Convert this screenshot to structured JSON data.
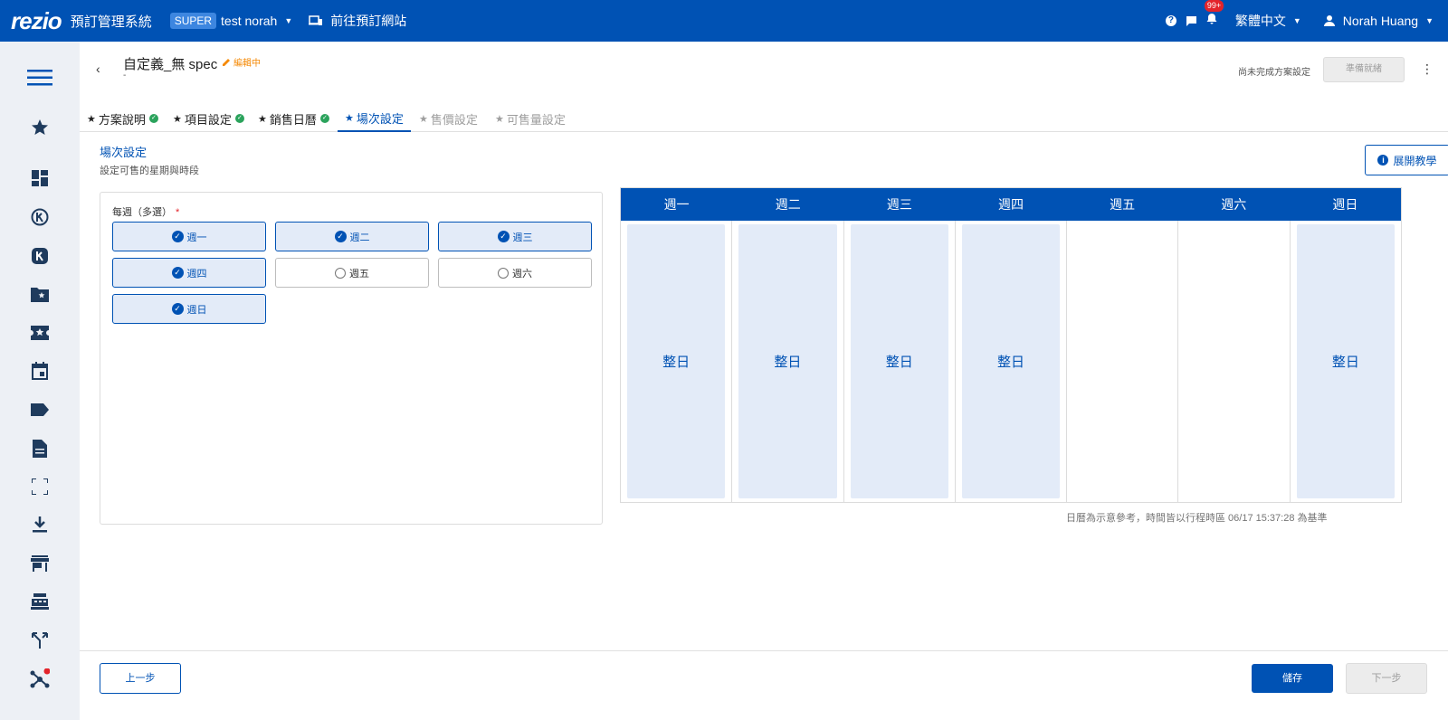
{
  "topbar": {
    "logo": "rezio",
    "system_title": "預訂管理系統",
    "super_badge": "SUPER",
    "org_name": "test norah",
    "site_link": "前往預訂網站",
    "notification_count": "99+",
    "language": "繁體中文",
    "user_name": "Norah Huang"
  },
  "sidebar": {
    "icons": [
      "menu-icon",
      "star-icon",
      "dashboard-icon",
      "k-circle-icon",
      "k-square-icon",
      "folder-star-icon",
      "ticket-star-icon",
      "calendar-icon",
      "tag-icon",
      "document-icon",
      "fullscreen-icon",
      "download-icon",
      "store-icon",
      "cashier-icon",
      "split-icon",
      "network-icon"
    ]
  },
  "header": {
    "back": "‹",
    "title": "自定義_無 spec",
    "edit_status": "編輯中",
    "subtitle": "-",
    "incomplete_text": "尚未完成方案設定",
    "ready_button": "準備就緒",
    "more": "⋮"
  },
  "tabs": [
    {
      "label": "方案說明",
      "state": "done"
    },
    {
      "label": "項目設定",
      "state": "done"
    },
    {
      "label": "銷售日曆",
      "state": "done"
    },
    {
      "label": "場次設定",
      "state": "active"
    },
    {
      "label": "售價設定",
      "state": "disabled"
    },
    {
      "label": "可售量設定",
      "state": "disabled"
    }
  ],
  "section": {
    "title": "場次設定",
    "description": "設定可售的星期與時段",
    "tutorial_button": "展開教學"
  },
  "week_selector": {
    "label": "每週（多選）",
    "required_mark": "*",
    "days": [
      {
        "label": "週一",
        "selected": true
      },
      {
        "label": "週二",
        "selected": true
      },
      {
        "label": "週三",
        "selected": true
      },
      {
        "label": "週四",
        "selected": true
      },
      {
        "label": "週五",
        "selected": false
      },
      {
        "label": "週六",
        "selected": false
      },
      {
        "label": "週日",
        "selected": true
      }
    ]
  },
  "calendar": {
    "headers": [
      "週一",
      "週二",
      "週三",
      "週四",
      "週五",
      "週六",
      "週日"
    ],
    "slots": [
      "整日",
      "整日",
      "整日",
      "整日",
      "",
      "",
      "整日"
    ],
    "note": "日曆為示意參考，時間皆以行程時區  06/17 15:37:28 為基準"
  },
  "footer": {
    "prev_button": "上一步",
    "save_button": "儲存",
    "next_button": "下一步"
  },
  "colors": {
    "primary": "#0052b4",
    "selected_bg": "#e3ebf8",
    "edit_orange": "#f58a07",
    "done_green": "#2ba35c",
    "badge_red": "#e3242b"
  }
}
